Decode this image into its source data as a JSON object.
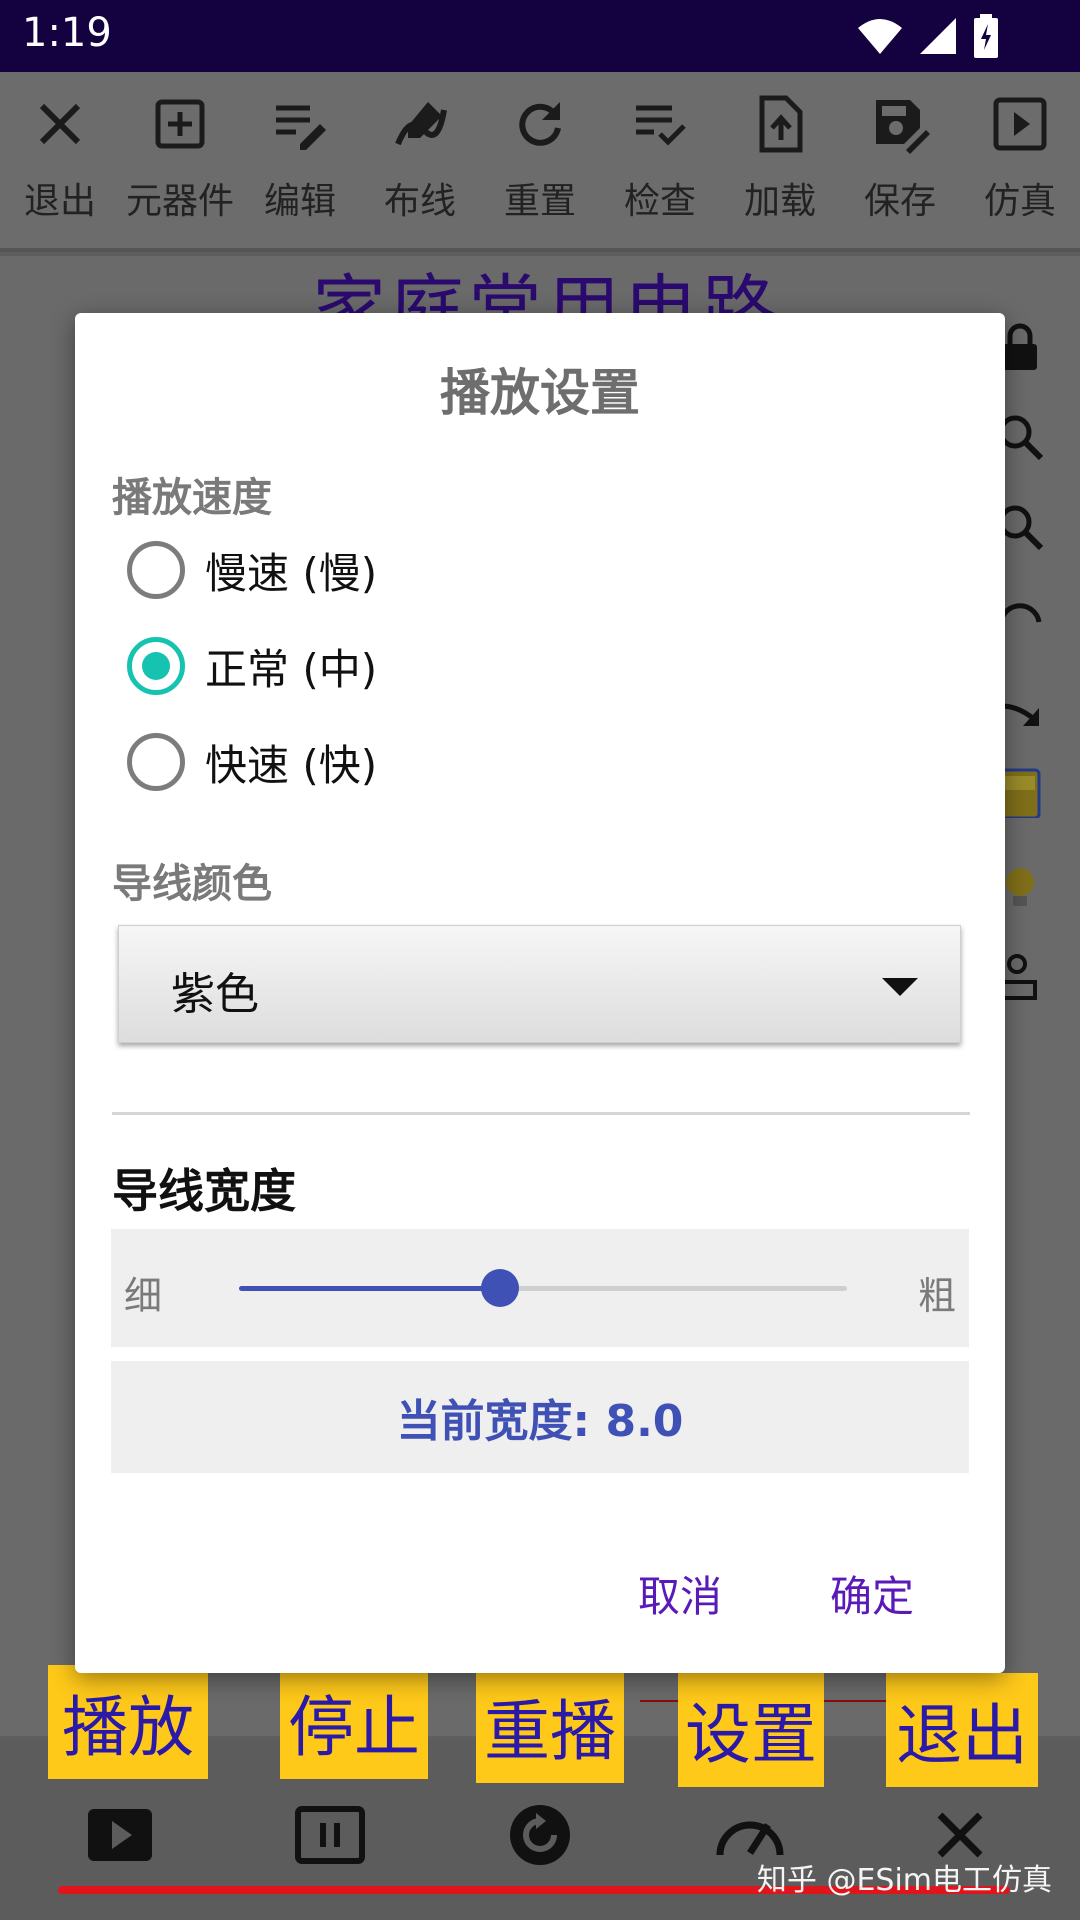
{
  "status_bar": {
    "time": "1:19"
  },
  "toolbar": {
    "items": [
      {
        "label": "退出",
        "icon": "close-icon"
      },
      {
        "label": "元器件",
        "icon": "add-box-icon"
      },
      {
        "label": "编辑",
        "icon": "edit-note-icon"
      },
      {
        "label": "布线",
        "icon": "draw-icon"
      },
      {
        "label": "重置",
        "icon": "refresh-icon"
      },
      {
        "label": "检查",
        "icon": "checklist-icon"
      },
      {
        "label": "加载",
        "icon": "upload-file-icon"
      },
      {
        "label": "保存",
        "icon": "save-edit-icon"
      },
      {
        "label": "仿真",
        "icon": "play-box-icon"
      }
    ]
  },
  "canvas": {
    "title": "家庭常用电路"
  },
  "dialog": {
    "title": "播放设置",
    "speed": {
      "label": "播放速度",
      "options": [
        {
          "label": "慢速 (慢)",
          "checked": false
        },
        {
          "label": "正常 (中)",
          "checked": true
        },
        {
          "label": "快速 (快)",
          "checked": false
        }
      ]
    },
    "wire_color": {
      "label": "导线颜色",
      "selected": "紫色"
    },
    "wire_width": {
      "label": "导线宽度",
      "min_label": "细",
      "max_label": "粗",
      "slider_fraction": 0.43,
      "current_text": "当前宽度: 8.0"
    },
    "cancel_label": "取消",
    "ok_label": "确定"
  },
  "annotations": [
    "播放",
    "停止",
    "重播",
    "设置",
    "退出"
  ],
  "play_bar": {
    "buttons": [
      "play-icon",
      "pause-icon",
      "replay-icon",
      "speed-icon",
      "close-icon"
    ]
  },
  "watermark": "知乎 @ESim电工仿真",
  "colors": {
    "accent": "#16c3b0",
    "slider": "#3f51b5",
    "dialog_button": "#5a1ab8",
    "status_bar": "#14013f",
    "annotation": "#ffc91a"
  }
}
